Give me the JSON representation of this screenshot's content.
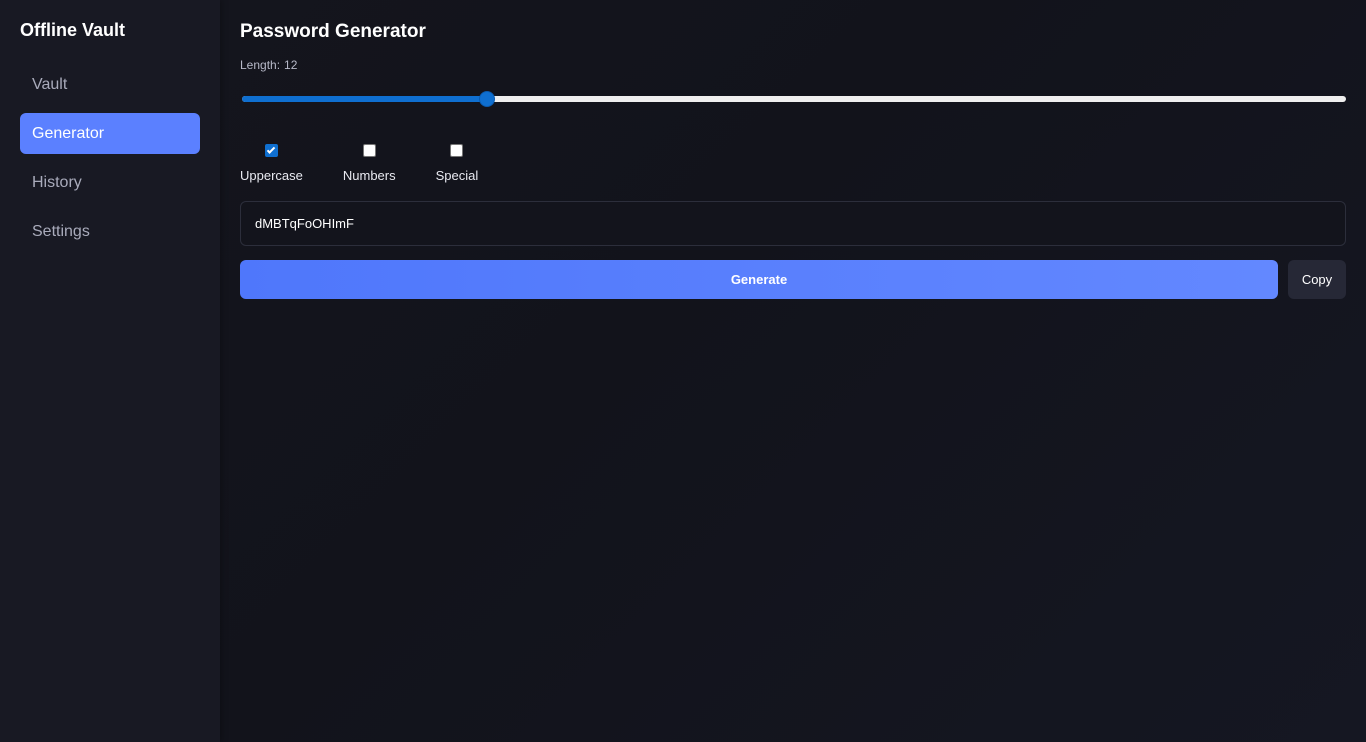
{
  "sidebar": {
    "app_title": "Offline Vault",
    "items": [
      {
        "label": "Vault",
        "active": false
      },
      {
        "label": "Generator",
        "active": true
      },
      {
        "label": "History",
        "active": false
      },
      {
        "label": "Settings",
        "active": false
      }
    ]
  },
  "generator": {
    "title": "Password Generator",
    "length_label": "Length:",
    "length_value": "12",
    "slider": {
      "min": 4,
      "max": 40,
      "value": 12,
      "fill_color": "#0f6fd0"
    },
    "options": [
      {
        "label": "Uppercase",
        "checked": true
      },
      {
        "label": "Numbers",
        "checked": false
      },
      {
        "label": "Special",
        "checked": false
      }
    ],
    "password_value": "dMBTqFoOHImF",
    "generate_label": "Generate",
    "copy_label": "Copy"
  },
  "colors": {
    "accent": "#5b80ff",
    "background": "#13141c",
    "sidebar": "#181923"
  }
}
